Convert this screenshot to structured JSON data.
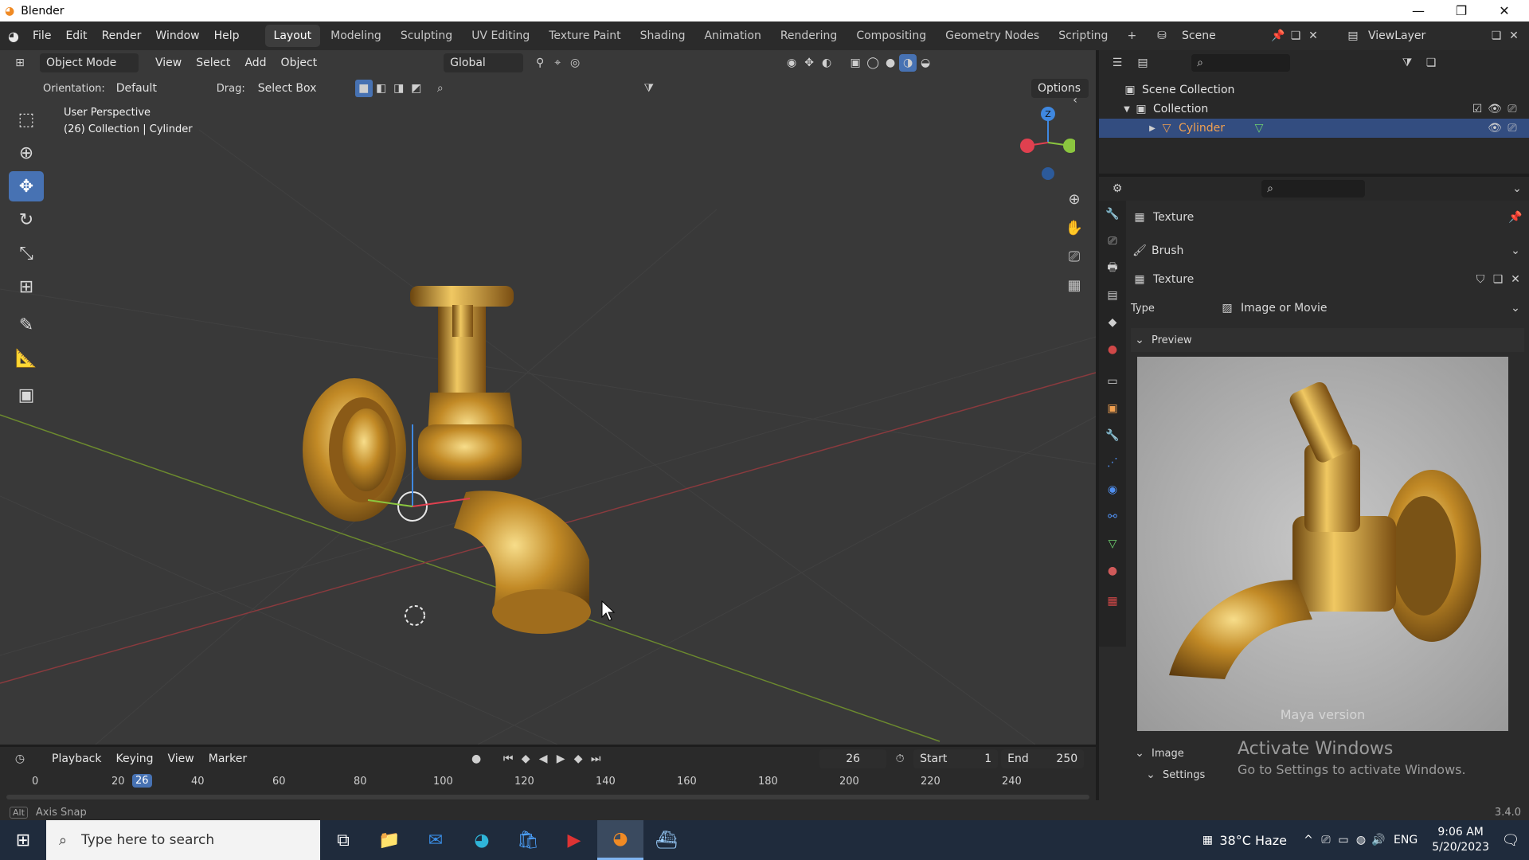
{
  "window": {
    "title": "Blender"
  },
  "menu": {
    "items": [
      "File",
      "Edit",
      "Render",
      "Window",
      "Help"
    ]
  },
  "workspaces": [
    "Layout",
    "Modeling",
    "Sculpting",
    "UV Editing",
    "Texture Paint",
    "Shading",
    "Animation",
    "Rendering",
    "Compositing",
    "Geometry Nodes",
    "Scripting"
  ],
  "active_workspace": "Layout",
  "scene": {
    "name": "Scene",
    "view_layer": "ViewLayer"
  },
  "viewport": {
    "mode": "Object Mode",
    "menus": [
      "View",
      "Select",
      "Add",
      "Object"
    ],
    "transform": "Global",
    "orientation_label": "Orientation:",
    "orientation_value": "Default",
    "drag_label": "Drag:",
    "drag_value": "Select Box",
    "options_label": "Options",
    "overlay_title": "User Perspective",
    "overlay_subtitle": "(26) Collection | Cylinder",
    "gizmo_z": "Z"
  },
  "outliner": {
    "root": "Scene Collection",
    "collection": "Collection",
    "object": "Cylinder"
  },
  "properties": {
    "panel_title": "Texture",
    "brush_label": "Brush",
    "texture_name": "Texture",
    "type_label": "Type",
    "type_value": "Image or Movie",
    "preview_label": "Preview",
    "preview_watermark": "Maya version",
    "image_label": "Image",
    "settings_label": "Settings"
  },
  "timeline": {
    "menus": [
      "Playback",
      "Keying",
      "View",
      "Marker"
    ],
    "current_frame": "26",
    "start_label": "Start",
    "start_value": "1",
    "end_label": "End",
    "end_value": "250",
    "ticks": [
      "0",
      "20",
      "26",
      "40",
      "60",
      "80",
      "100",
      "120",
      "140",
      "160",
      "180",
      "200",
      "220",
      "240"
    ]
  },
  "status": {
    "left": "Axis Snap",
    "left_key": "Alt",
    "version": "3.4.0"
  },
  "activation": {
    "line1": "Activate Windows",
    "line2": "Go to Settings to activate Windows."
  },
  "taskbar": {
    "search_placeholder": "Type here to search",
    "weather": "38°C  Haze",
    "lang": "ENG",
    "time": "9:06 AM",
    "date": "5/20/2023"
  },
  "colors": {
    "accent": "#4772b3",
    "gold": "#c89a2e",
    "x_axis": "#e0404f",
    "y_axis": "#8bc63f",
    "z_axis": "#3f88e0"
  }
}
